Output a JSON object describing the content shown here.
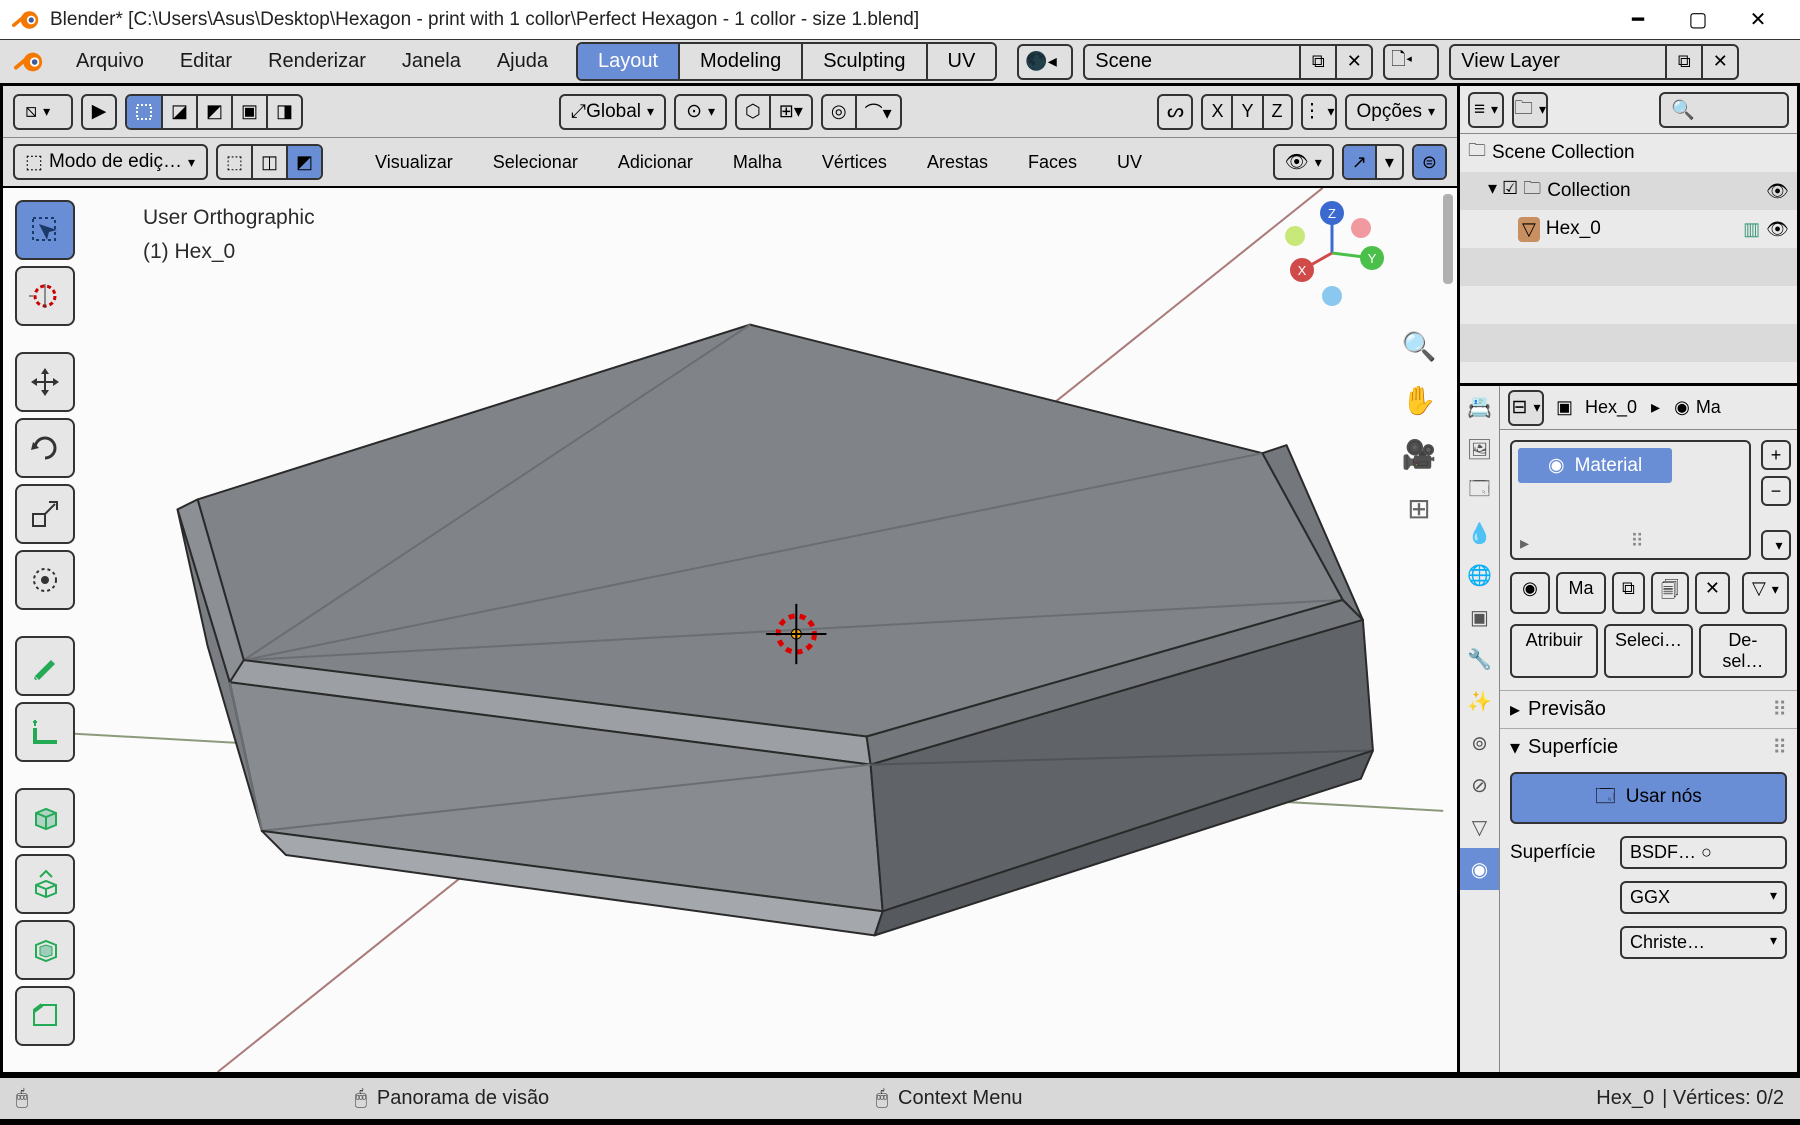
{
  "title": "Blender* [C:\\Users\\Asus\\Desktop\\Hexagon - print with 1 collor\\Perfect Hexagon - 1 collor - size 1.blend]",
  "menu": {
    "file": "Arquivo",
    "edit": "Editar",
    "render": "Renderizar",
    "window": "Janela",
    "help": "Ajuda"
  },
  "tabs": {
    "layout": "Layout",
    "modeling": "Modeling",
    "sculpting": "Sculpting",
    "uv": "UV"
  },
  "scene": {
    "label": "Scene",
    "vlayer": "View Layer"
  },
  "vhead": {
    "global": "Global",
    "options": "Opções",
    "x": "X",
    "y": "Y",
    "z": "Z",
    "mode": "Modo de ediç…",
    "visualize": "Visualizar",
    "select": "Selecionar",
    "add": "Adicionar",
    "mesh": "Malha",
    "vertex": "Vértices",
    "edge": "Arestas",
    "face": "Faces",
    "uv": "UV"
  },
  "viewport": {
    "ortho": "User Orthographic",
    "obj": "(1) Hex_0"
  },
  "outliner": {
    "scenecoll": "Scene Collection",
    "collection": "Collection",
    "hex": "Hex_0"
  },
  "props": {
    "bread_obj": "Hex_0",
    "bread_mat": "Ma",
    "material": "Material",
    "matshort": "Ma",
    "assign": "Atribuir",
    "select": "Seleci…",
    "deselect": "De-sel…",
    "preview": "Previsão",
    "surface": "Superfície",
    "usenodes": "Usar nós",
    "surflabel": "Superfície",
    "bsdf": "BSDF… ○",
    "ggx": "GGX",
    "christe": "Christe…"
  },
  "status": {
    "pan": "Panorama de visão",
    "ctx": "Context Menu",
    "obj": "Hex_0",
    "verts": "Vértices: 0/2"
  }
}
